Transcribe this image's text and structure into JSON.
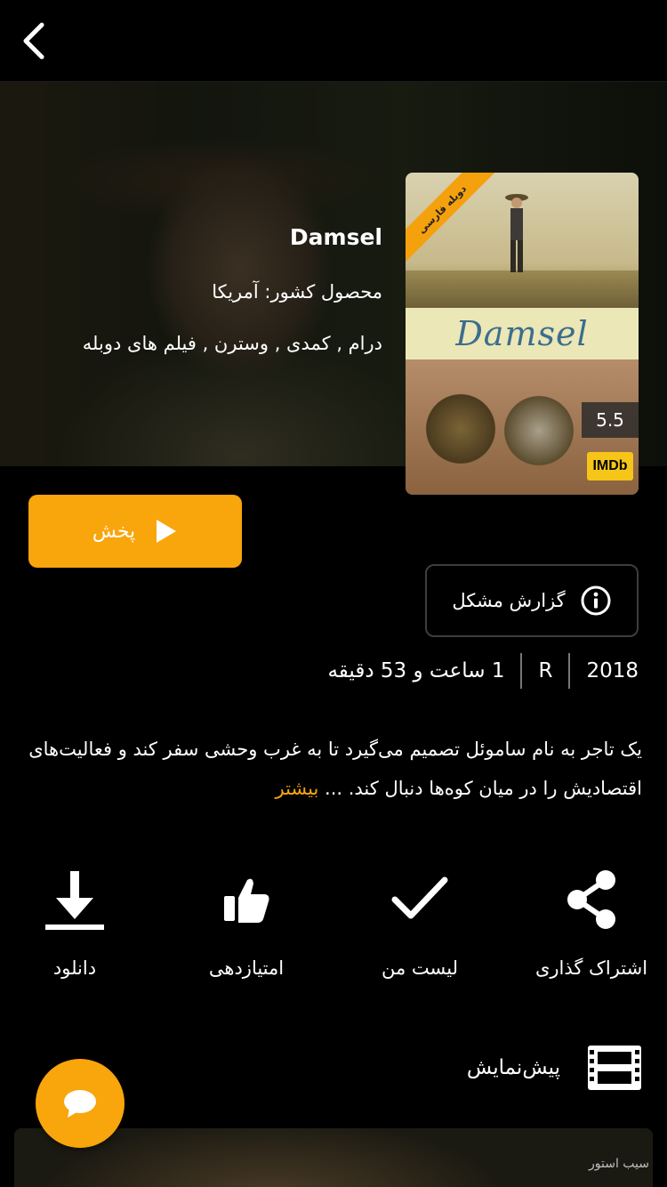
{
  "movie": {
    "title": "Damsel",
    "country_line": "محصول کشور: آمریکا",
    "genres": "درام , کمدی , وسترن , فیلم های دوبله",
    "poster_title": "Damsel",
    "dub_ribbon": "دوبله فارسی",
    "imdb_score": "5.5",
    "imdb_logo": "IMDb"
  },
  "buttons": {
    "play_label": "پخش",
    "report_label": "گزارش مشکل"
  },
  "meta": {
    "year": "2018",
    "rating": "R",
    "duration": "1 ساعت و 53 دقیقه"
  },
  "description": {
    "text": "یک تاجر به نام ساموئل تصمیم می‌گیرد تا به غرب وحشی سفر کند و فعالیت‌های اقتصادیش را در میان کوه‌ها دنبال کند. ...",
    "more": "بیشتر"
  },
  "actions": [
    {
      "label": "اشتراک گذاری",
      "icon": "share-icon"
    },
    {
      "label": "لیست من",
      "icon": "check-icon"
    },
    {
      "label": "امتیازدهی",
      "icon": "thumbs-up-icon"
    },
    {
      "label": "دانلود",
      "icon": "download-icon"
    }
  ],
  "trailer": {
    "title": "پیش‌نمایش",
    "icon": "film-strip-icon"
  },
  "watermark": "سیب استور",
  "colors": {
    "accent": "#f9a50c",
    "background": "#000000",
    "imdb": "#f5c518"
  }
}
